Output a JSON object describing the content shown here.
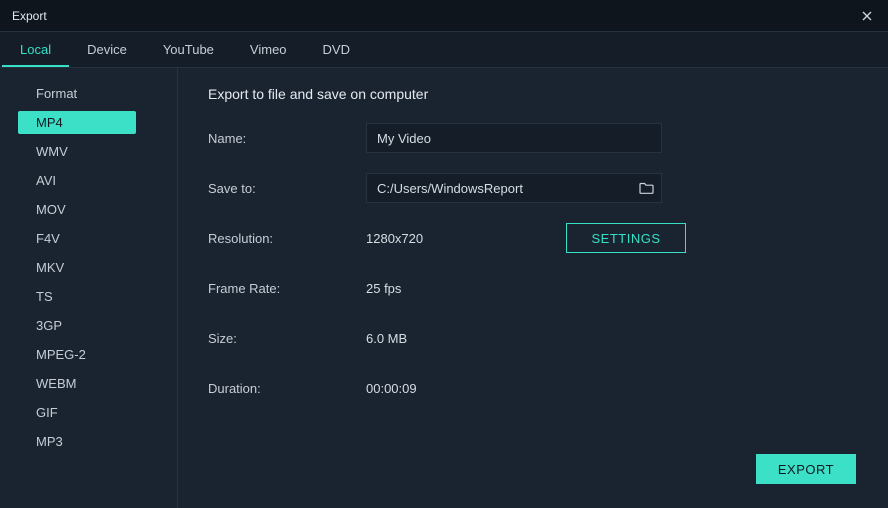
{
  "window": {
    "title": "Export"
  },
  "tabs": {
    "local": "Local",
    "device": "Device",
    "youtube": "YouTube",
    "vimeo": "Vimeo",
    "dvd": "DVD",
    "active": "local"
  },
  "sidebar": {
    "heading": "Format",
    "formats": [
      "MP4",
      "WMV",
      "AVI",
      "MOV",
      "F4V",
      "MKV",
      "TS",
      "3GP",
      "MPEG-2",
      "WEBM",
      "GIF",
      "MP3"
    ],
    "active": "MP4"
  },
  "panel": {
    "heading": "Export to file and save on computer",
    "labels": {
      "name": "Name:",
      "save_to": "Save to:",
      "resolution": "Resolution:",
      "frame_rate": "Frame Rate:",
      "size": "Size:",
      "duration": "Duration:"
    },
    "values": {
      "name": "My Video",
      "save_to": "C:/Users/WindowsReport",
      "resolution": "1280x720",
      "frame_rate": "25 fps",
      "size": "6.0 MB",
      "duration": "00:00:09"
    },
    "settings_btn": "SETTINGS",
    "export_btn": "EXPORT"
  }
}
